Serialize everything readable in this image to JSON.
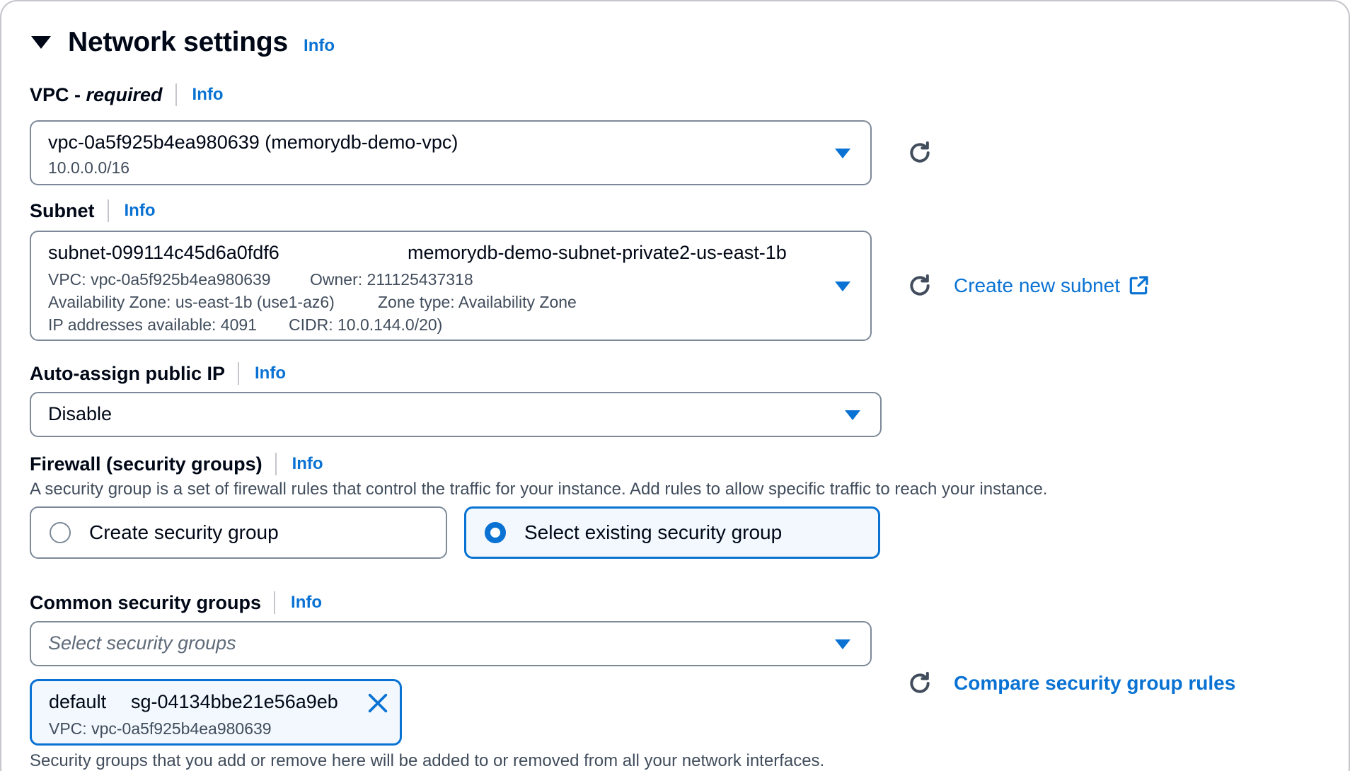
{
  "section": {
    "title": "Network settings",
    "info": "Info"
  },
  "vpc": {
    "label_main": "VPC - ",
    "label_required": "required",
    "info": "Info",
    "value": "vpc-0a5f925b4ea980639 (memorydb-demo-vpc)",
    "cidr": "10.0.0.0/16"
  },
  "subnet": {
    "label": "Subnet",
    "info": "Info",
    "id": "subnet-099114c45d6a0fdf6",
    "name": "memorydb-demo-subnet-private2-us-east-1b",
    "vpc": "VPC: vpc-0a5f925b4ea980639",
    "owner": "Owner: 211125437318",
    "az": "Availability Zone: us-east-1b (use1-az6)",
    "zone_type": "Zone type: Availability Zone",
    "ips": "IP addresses available: 4091",
    "cidr": "CIDR: 10.0.144.0/20)",
    "create_link": "Create new subnet"
  },
  "public_ip": {
    "label": "Auto-assign public IP",
    "info": "Info",
    "value": "Disable"
  },
  "firewall": {
    "label": "Firewall (security groups)",
    "info": "Info",
    "description": "A security group is a set of firewall rules that control the traffic for your instance. Add rules to allow specific traffic to reach your instance.",
    "option_create": "Create security group",
    "option_existing": "Select existing security group",
    "selected": "existing"
  },
  "common_sg": {
    "label": "Common security groups",
    "info": "Info",
    "placeholder": "Select security groups",
    "compare_link": "Compare security group rules",
    "token": {
      "name": "default",
      "id": "sg-04134bbe21e56a9eb",
      "vpc": "VPC: vpc-0a5f925b4ea980639"
    },
    "footer": "Security groups that you add or remove here will be added to or removed from all your network interfaces."
  },
  "colors": {
    "link": "#0972d3",
    "text": "#000716",
    "secondary": "#414d5c",
    "border": "#7d8998",
    "selected_bg": "#f2f8fd"
  }
}
